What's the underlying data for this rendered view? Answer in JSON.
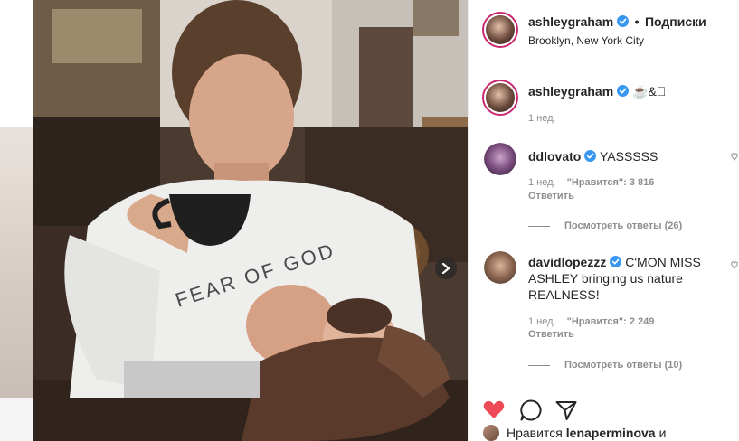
{
  "post": {
    "author": "ashleygraham",
    "follow_dot": "•",
    "follow_label": "Подписки",
    "location": "Brooklyn, New York City"
  },
  "caption": {
    "username": "ashleygraham",
    "text": "☕&🏽",
    "time": "1 нед."
  },
  "comments": [
    {
      "username": "ddlovato",
      "text": "YASSSSS",
      "time": "1 нед.",
      "likes": "\"Нравится\": 3 816",
      "reply_label": "Ответить",
      "view_replies": "Посмотреть ответы (26)"
    },
    {
      "username": "davidlopezzz",
      "text": "C'MON MISS ASHLEY bringing us nature REALNESS!",
      "time": "1 нед.",
      "likes": "\"Нравится\": 2 249",
      "reply_label": "Ответить",
      "view_replies": "Посмотреть ответы (10)"
    }
  ],
  "footer": {
    "likes_prefix": "Нравится",
    "liked_by": "lenaperminova",
    "suffix": "и"
  },
  "colors": {
    "heart": "#ed4956",
    "verified": "#3897f0",
    "muted": "#8e8e8e"
  },
  "icons": [
    "heart-icon",
    "comment-icon",
    "share-icon",
    "verified-icon",
    "chevron-right-icon"
  ]
}
